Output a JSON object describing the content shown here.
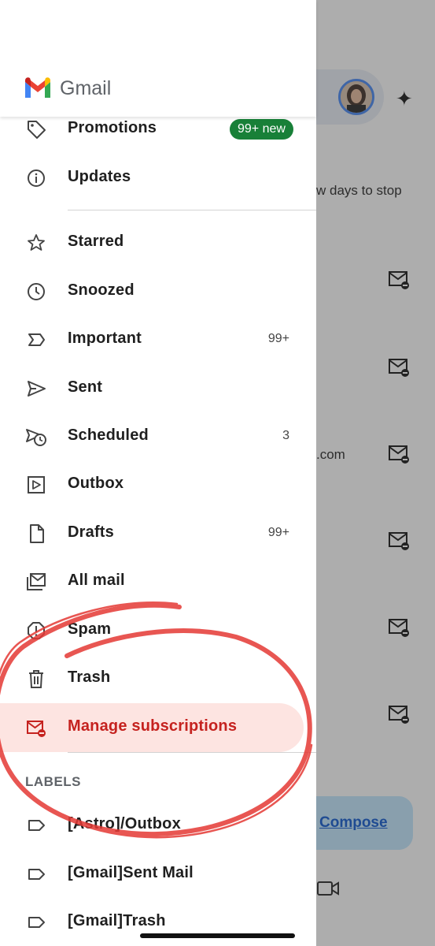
{
  "app": {
    "name": "Gmail"
  },
  "background": {
    "snippet_1": "w days to stop",
    "snippet_2": ".com",
    "compose_label": "Compose"
  },
  "drawer": {
    "items": [
      {
        "label": "Promotions",
        "badge": "99+ new",
        "icon": "tag-icon"
      },
      {
        "label": "Updates",
        "icon": "info-icon"
      },
      {
        "label": "Starred",
        "icon": "star-icon"
      },
      {
        "label": "Snoozed",
        "icon": "clock-icon"
      },
      {
        "label": "Important",
        "count": "99+",
        "icon": "important-icon"
      },
      {
        "label": "Sent",
        "icon": "send-icon"
      },
      {
        "label": "Scheduled",
        "count": "3",
        "icon": "scheduled-icon"
      },
      {
        "label": "Outbox",
        "icon": "outbox-icon"
      },
      {
        "label": "Drafts",
        "count": "99+",
        "icon": "draft-icon"
      },
      {
        "label": "All mail",
        "icon": "all-mail-icon"
      },
      {
        "label": "Spam",
        "icon": "spam-icon"
      },
      {
        "label": "Trash",
        "icon": "trash-icon"
      },
      {
        "label": "Manage subscriptions",
        "icon": "manage-subscriptions-icon",
        "selected": true
      }
    ],
    "labels_heading": "LABELS",
    "labels": [
      {
        "label": "[Astro]/Outbox"
      },
      {
        "label": "[Gmail]Sent Mail"
      },
      {
        "label": "[Gmail]Trash"
      }
    ]
  },
  "colors": {
    "badge_green": "#188038",
    "selected_bg": "#fde4e1",
    "selected_text": "#c5221f",
    "annotation_red": "#e53935"
  }
}
